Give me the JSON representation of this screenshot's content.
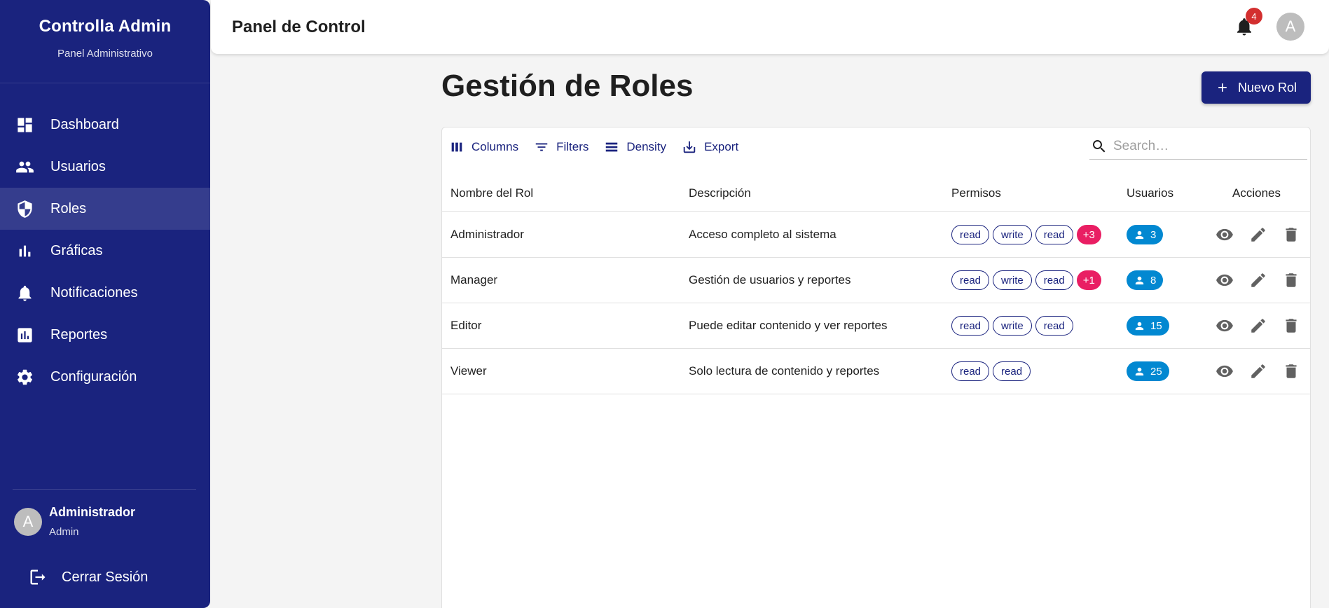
{
  "sidebar": {
    "brand_title": "Controlla Admin",
    "brand_subtitle": "Panel Administrativo",
    "items": [
      {
        "label": "Dashboard",
        "icon": "dashboard-icon"
      },
      {
        "label": "Usuarios",
        "icon": "people-icon"
      },
      {
        "label": "Roles",
        "icon": "shield-icon",
        "active": true
      },
      {
        "label": "Gráficas",
        "icon": "bar-chart-icon"
      },
      {
        "label": "Notificaciones",
        "icon": "bell-icon"
      },
      {
        "label": "Reportes",
        "icon": "report-icon"
      },
      {
        "label": "Configuración",
        "icon": "gear-icon"
      }
    ],
    "user": {
      "avatar_letter": "A",
      "name": "Administrador",
      "role": "Admin"
    },
    "logout_label": "Cerrar Sesión"
  },
  "header": {
    "title": "Panel de Control",
    "notification_count": "4",
    "avatar_letter": "A"
  },
  "main": {
    "title": "Gestión de Roles",
    "new_button_label": "Nuevo Rol"
  },
  "grid": {
    "toolbar": {
      "columns_label": "Columns",
      "filters_label": "Filters",
      "density_label": "Density",
      "export_label": "Export"
    },
    "search_placeholder": "Search…",
    "columns": [
      "Nombre del Rol",
      "Descripción",
      "Permisos",
      "Usuarios",
      "Acciones"
    ],
    "rows": [
      {
        "name": "Administrador",
        "description": "Acceso completo al sistema",
        "permissions": [
          "read",
          "write",
          "read"
        ],
        "extra": "+3",
        "users": "3"
      },
      {
        "name": "Manager",
        "description": "Gestión de usuarios y reportes",
        "permissions": [
          "read",
          "write",
          "read"
        ],
        "extra": "+1",
        "users": "8"
      },
      {
        "name": "Editor",
        "description": "Puede editar contenido y ver reportes",
        "permissions": [
          "read",
          "write",
          "read"
        ],
        "extra": "",
        "users": "15"
      },
      {
        "name": "Viewer",
        "description": "Solo lectura de contenido y reportes",
        "permissions": [
          "read",
          "read"
        ],
        "extra": "",
        "users": "25"
      }
    ]
  },
  "colors": {
    "primary": "#1a237e",
    "badge_red": "#d32f2f",
    "chip_pink": "#e91e63",
    "user_chip_blue": "#0288d1"
  }
}
